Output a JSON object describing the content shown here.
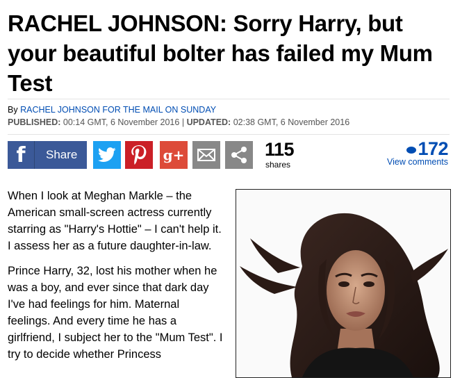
{
  "headline": "RACHEL JOHNSON: Sorry Harry, but your beautiful bolter has failed my Mum Test",
  "byline": {
    "prefix": "By",
    "author": "RACHEL JOHNSON FOR THE MAIL ON SUNDAY"
  },
  "dates": {
    "published_label": "PUBLISHED:",
    "published_value": "00:14 GMT, 6 November 2016",
    "separator": "|",
    "updated_label": "UPDATED:",
    "updated_value": "02:38 GMT, 6 November 2016"
  },
  "share": {
    "facebook_label": "Share",
    "share_count": "115",
    "share_count_label": "shares",
    "comment_count": "172",
    "comments_label": "View comments",
    "icons": [
      "facebook-icon",
      "twitter-icon",
      "pinterest-icon",
      "google-plus-icon",
      "email-icon",
      "share-icon"
    ],
    "google_plus_text": "g+",
    "facebook_glyph": "f"
  },
  "article": {
    "paragraphs": [
      "When I look at Meghan Markle – the American small-screen actress currently starring as \"Harry's Hottie\" – I can't help it. I assess her as a future daughter-in-law.",
      "Prince Harry, 32, lost his mother when he was a boy, and ever since that dark day I've had feelings for him. Maternal feelings. And every time he has a girlfriend, I subject her to the \"Mum Test\". I try to decide whether Princess"
    ]
  },
  "colors": {
    "link": "#004db3",
    "facebook": "#3b5998",
    "twitter": "#1da1f2",
    "pinterest": "#cb2027",
    "google_plus": "#dd4b39",
    "grey_button": "#888888"
  }
}
